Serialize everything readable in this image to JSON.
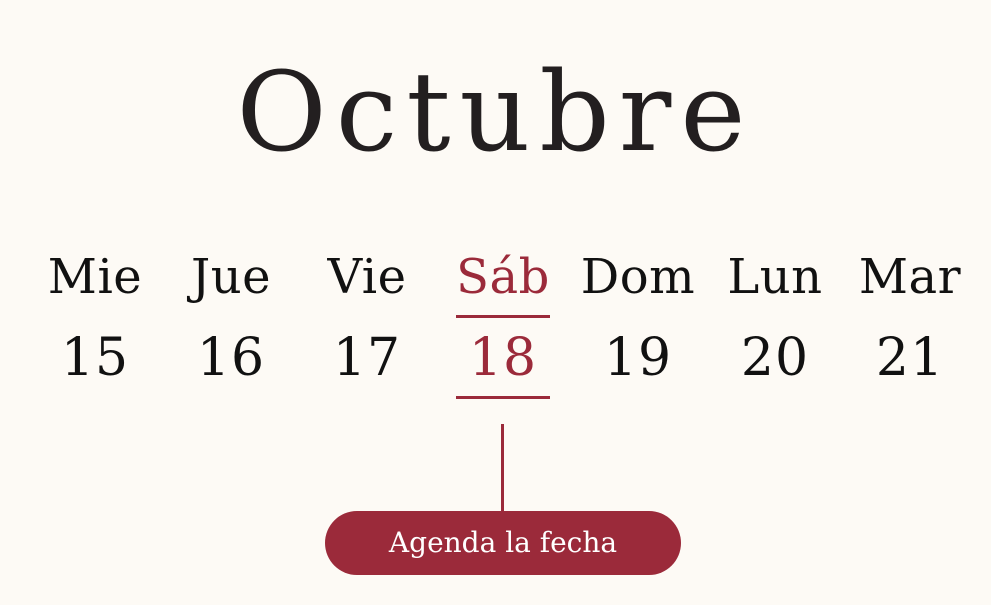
{
  "header": {
    "month": "Octubre"
  },
  "week": {
    "days": [
      {
        "name": "Mie",
        "number": "15",
        "highlighted": false
      },
      {
        "name": "Jue",
        "number": "16",
        "highlighted": false
      },
      {
        "name": "Vie",
        "number": "17",
        "highlighted": false
      },
      {
        "name": "Sáb",
        "number": "18",
        "highlighted": true
      },
      {
        "name": "Dom",
        "number": "19",
        "highlighted": false
      },
      {
        "name": "Lun",
        "number": "20",
        "highlighted": false
      },
      {
        "name": "Mar",
        "number": "21",
        "highlighted": false
      }
    ]
  },
  "cta": {
    "label": "Agenda la fecha"
  },
  "colors": {
    "background": "#fdfaf5",
    "accent": "#9b2a3a",
    "text": "#111111",
    "title": "#231f20"
  }
}
